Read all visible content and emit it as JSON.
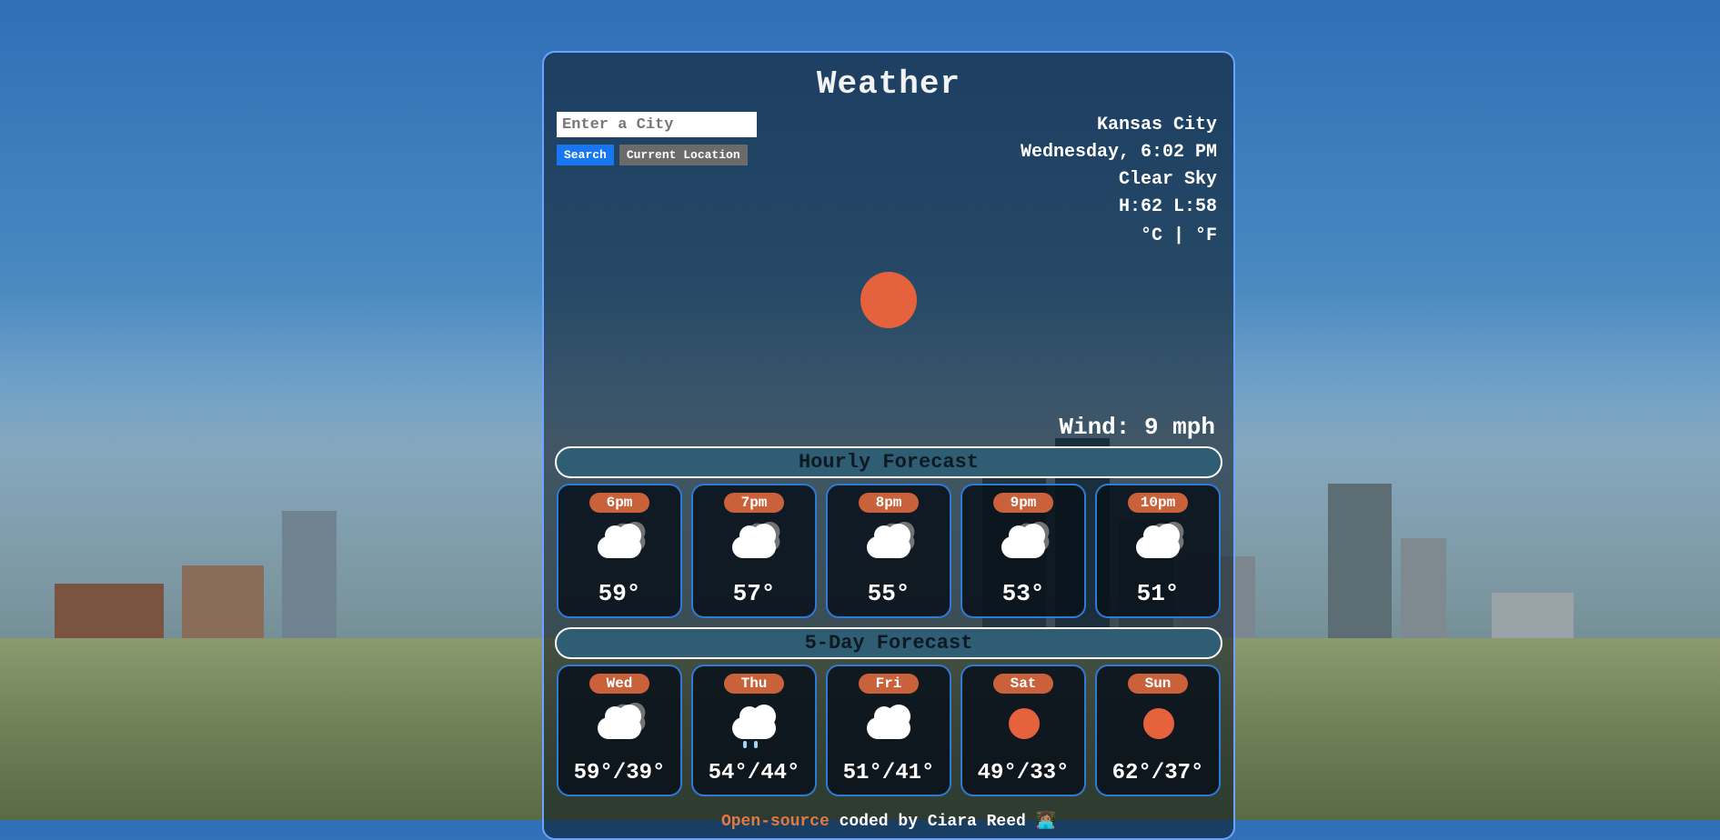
{
  "title": "Weather",
  "search": {
    "placeholder": "Enter a City",
    "value": "",
    "searchLabel": "Search",
    "currentLocationLabel": "Current Location"
  },
  "location": {
    "city": "Kansas City",
    "datetime": "Wednesday, 6:02 PM",
    "condition": "Clear Sky",
    "hiLo": "H:62 L:58"
  },
  "units": {
    "c": "°C",
    "sep": " | ",
    "f": "°F"
  },
  "currentIcon": "sun",
  "wind": "Wind: 9 mph",
  "hourlyHeader": "Hourly Forecast",
  "hourly": [
    {
      "label": "6pm",
      "icon": "clouds",
      "temp": "59°"
    },
    {
      "label": "7pm",
      "icon": "clouds",
      "temp": "57°"
    },
    {
      "label": "8pm",
      "icon": "clouds",
      "temp": "55°"
    },
    {
      "label": "9pm",
      "icon": "clouds",
      "temp": "53°"
    },
    {
      "label": "10pm",
      "icon": "clouds",
      "temp": "51°"
    }
  ],
  "dailyHeader": "5-Day Forecast",
  "daily": [
    {
      "label": "Wed",
      "icon": "clouds",
      "temp": "59°/39°"
    },
    {
      "label": "Thu",
      "icon": "sun-rain",
      "temp": "54°/44°"
    },
    {
      "label": "Fri",
      "icon": "sun-cloud",
      "temp": "51°/41°"
    },
    {
      "label": "Sat",
      "icon": "sun",
      "temp": "49°/33°"
    },
    {
      "label": "Sun",
      "icon": "sun",
      "temp": "62°/37°"
    }
  ],
  "footer": {
    "link": "Open-source",
    "rest": " coded by Ciara Reed ",
    "emoji": "👩🏽‍💻"
  }
}
